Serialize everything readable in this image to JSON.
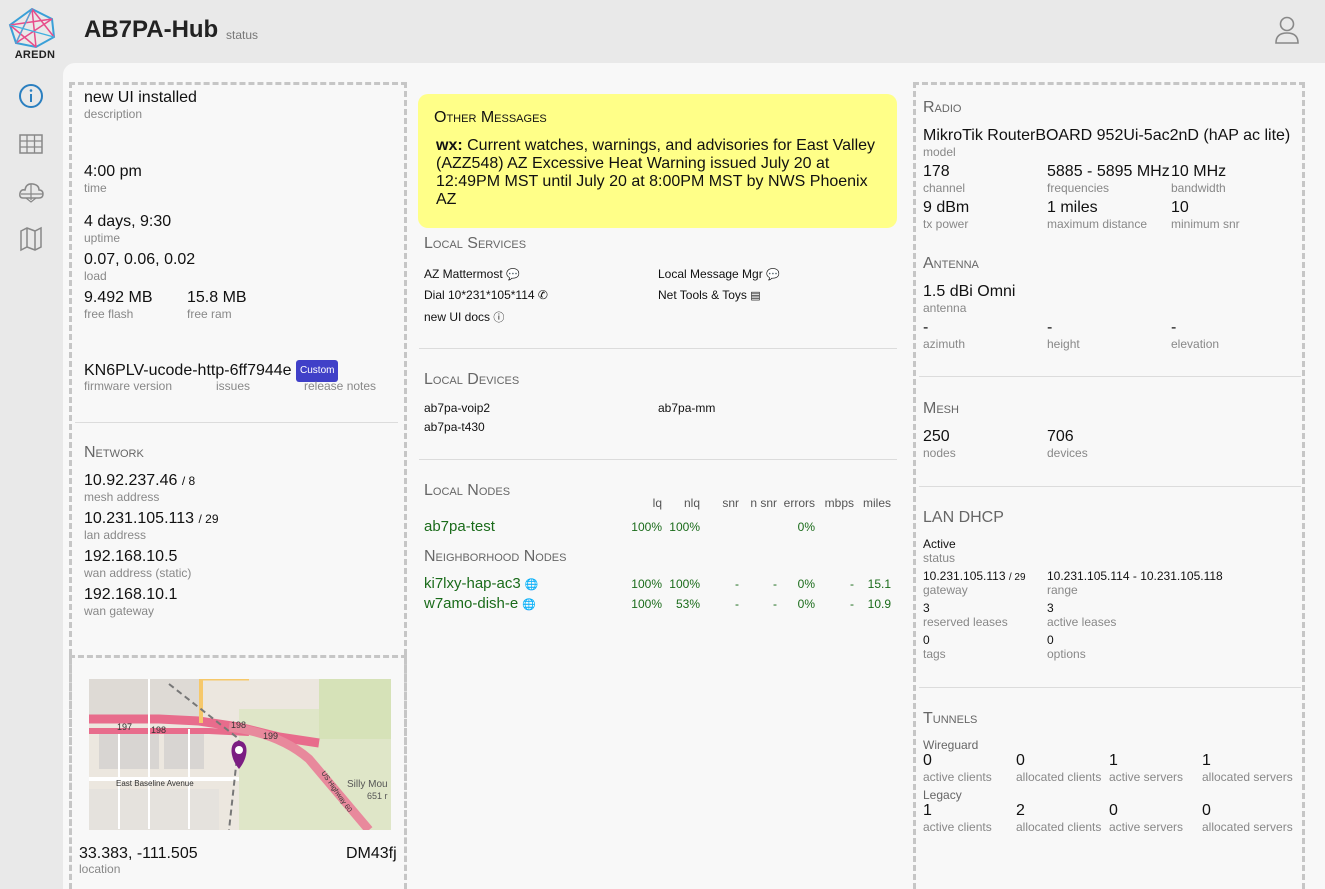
{
  "header": {
    "logo_text": "AREDN",
    "node_name": "AB7PA-Hub",
    "node_status": "status"
  },
  "sidebar": {
    "items": [
      "info-icon",
      "grid-icon",
      "mesh-cloud-icon",
      "map-icon"
    ]
  },
  "left": {
    "description": {
      "value": "new UI installed",
      "label": "description"
    },
    "time": {
      "value": "4:00 pm",
      "label": "time"
    },
    "uptime": {
      "value": "4 days, 9:30",
      "label": "uptime"
    },
    "load": {
      "value": "0.07, 0.06, 0.02",
      "label": "load"
    },
    "free_flash": {
      "value": "9.492 MB",
      "label": "free flash"
    },
    "free_ram": {
      "value": "15.8 MB",
      "label": "free ram"
    },
    "firmware": {
      "value": "KN6PLV-ucode-http-6ff7944e",
      "badge": "Custom",
      "label": "firmware version",
      "issues": "issues",
      "release_notes": "release notes"
    },
    "network": {
      "title": "Network",
      "mesh_address": {
        "value": "10.92.237.46",
        "suffix": "/ 8",
        "label": "mesh address"
      },
      "lan_address": {
        "value": "10.231.105.113",
        "suffix": "/ 29",
        "label": "lan address"
      },
      "wan_address": {
        "value": "192.168.10.5",
        "label": "wan address (static)"
      },
      "wan_gateway": {
        "value": "192.168.10.1",
        "label": "wan gateway"
      }
    },
    "location": {
      "coords": "33.383, -111.505",
      "grid": "DM43fj",
      "label": "location",
      "map_labels": {
        "r197": "197",
        "r198a": "198",
        "r198b": "198",
        "r199": "199",
        "street": "East Baseline Avenue",
        "highway": "US Highway 60",
        "place": "Silly Mou",
        "elev": "651 r"
      }
    }
  },
  "center": {
    "messages": {
      "title": "Other Messages",
      "prefix": "wx:",
      "text": "Current watches, warnings, and advisories for East Valley (AZZ548) AZ Excessive Heat Warning issued July 20 at 12:49PM MST until July 20 at 8:00PM MST by NWS Phoenix AZ"
    },
    "services": {
      "title": "Local Services",
      "items": [
        {
          "label": "AZ Mattermost",
          "icon": "chat-icon"
        },
        {
          "label": "Local Message Mgr",
          "icon": "chat-icon"
        },
        {
          "label": "Dial 10*231*105*114",
          "icon": "phone-icon"
        },
        {
          "label": "Net Tools & Toys",
          "icon": "server-icon"
        },
        {
          "label": "new UI docs",
          "icon": "info-icon"
        }
      ]
    },
    "devices": {
      "title": "Local Devices",
      "items": [
        "ab7pa-voip2",
        "ab7pa-mm",
        "ab7pa-t430"
      ]
    },
    "nodes": {
      "title": "Local Nodes",
      "columns": [
        "lq",
        "nlq",
        "snr",
        "n snr",
        "errors",
        "mbps",
        "miles"
      ],
      "local": [
        {
          "name": "ab7pa-test",
          "lq": "100%",
          "nlq": "100%",
          "snr": "",
          "nsnr": "",
          "errors": "0%",
          "mbps": "",
          "miles": ""
        }
      ],
      "neighborhood_title": "Neighborhood Nodes",
      "neighborhood": [
        {
          "name": "ki7lxy-hap-ac3",
          "lq": "100%",
          "nlq": "100%",
          "snr": "-",
          "nsnr": "-",
          "errors": "0%",
          "mbps": "-",
          "miles": "15.1"
        },
        {
          "name": "w7amo-dish-e",
          "lq": "100%",
          "nlq": "53%",
          "snr": "-",
          "nsnr": "-",
          "errors": "0%",
          "mbps": "-",
          "miles": "10.9"
        }
      ]
    }
  },
  "right": {
    "radio": {
      "title": "Radio",
      "model": "MikroTik RouterBOARD 952Ui-5ac2nD (hAP ac lite)",
      "model_label": "model",
      "channel": "178",
      "channel_label": "channel",
      "frequencies": "5885 - 5895 MHz",
      "frequencies_label": "frequencies",
      "bandwidth": "10 MHz",
      "bandwidth_label": "bandwidth",
      "tx_power": "9 dBm",
      "tx_power_label": "tx power",
      "max_distance": "1 miles",
      "max_distance_label": "maximum distance",
      "min_snr": "10",
      "min_snr_label": "minimum snr"
    },
    "antenna": {
      "title": "Antenna",
      "antenna": "1.5 dBi Omni",
      "antenna_label": "antenna",
      "azimuth": "-",
      "azimuth_label": "azimuth",
      "height": "-",
      "height_label": "height",
      "elevation": "-",
      "elevation_label": "elevation"
    },
    "mesh": {
      "title": "Mesh",
      "nodes": "250",
      "nodes_label": "nodes",
      "devices": "706",
      "devices_label": "devices"
    },
    "dhcp": {
      "title": "LAN DHCP",
      "status": "Active",
      "status_label": "status",
      "gateway": "10.231.105.113",
      "gateway_suffix": "/ 29",
      "gateway_label": "gateway",
      "range": "10.231.105.114 - 10.231.105.118",
      "range_label": "range",
      "reserved": "3",
      "reserved_label": "reserved leases",
      "active": "3",
      "active_label": "active leases",
      "tags": "0",
      "tags_label": "tags",
      "options": "0",
      "options_label": "options"
    },
    "tunnels": {
      "title": "Tunnels",
      "wireguard": {
        "label": "Wireguard",
        "active_clients": "0",
        "allocated_clients": "0",
        "active_servers": "1",
        "allocated_servers": "1"
      },
      "legacy": {
        "label": "Legacy",
        "active_clients": "1",
        "allocated_clients": "2",
        "active_servers": "0",
        "allocated_servers": "0"
      },
      "labels": {
        "active_clients": "active clients",
        "allocated_clients": "allocated clients",
        "active_servers": "active servers",
        "allocated_servers": "allocated servers"
      }
    }
  }
}
